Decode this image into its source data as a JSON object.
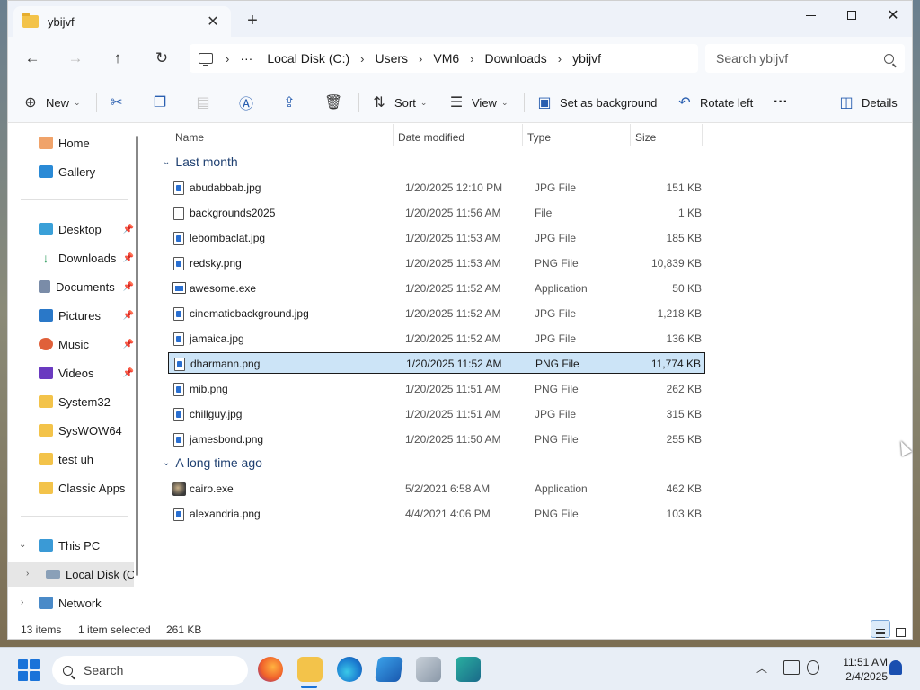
{
  "window": {
    "tab_title": "ybijvf",
    "tab_close": "✕",
    "new_tab": "+"
  },
  "address": {
    "ellipsis": "···",
    "crumbs": [
      "Local Disk (C:)",
      "Users",
      "VM6",
      "Downloads",
      "ybijvf"
    ],
    "separator": "›",
    "search_placeholder": "Search ybijvf"
  },
  "commands": {
    "new_label": "New",
    "sort_label": "Sort",
    "view_label": "View",
    "set_bg_label": "Set as background",
    "rotate_label": "Rotate left",
    "more_label": "···",
    "details_label": "Details"
  },
  "sidebar": {
    "home": "Home",
    "gallery": "Gallery",
    "desktop": "Desktop",
    "downloads": "Downloads",
    "documents": "Documents",
    "pictures": "Pictures",
    "music": "Music",
    "videos": "Videos",
    "system32": "System32",
    "syswow64": "SysWOW64",
    "test_uh": "test uh",
    "classic_apps": "Classic Apps",
    "this_pc": "This PC",
    "local_disk": "Local Disk (C:",
    "network": "Network"
  },
  "columns": {
    "name": "Name",
    "date": "Date modified",
    "type": "Type",
    "size": "Size"
  },
  "groups": {
    "last_month": "Last month",
    "long_ago": "A long time ago"
  },
  "files_last_month": [
    {
      "name": "abudabbab.jpg",
      "date": "1/20/2025 12:10 PM",
      "type": "JPG File",
      "size": "151 KB"
    },
    {
      "name": "backgrounds2025",
      "date": "1/20/2025 11:56 AM",
      "type": "File",
      "size": "1 KB"
    },
    {
      "name": "lebombaclat.jpg",
      "date": "1/20/2025 11:53 AM",
      "type": "JPG File",
      "size": "185 KB"
    },
    {
      "name": "redsky.png",
      "date": "1/20/2025 11:53 AM",
      "type": "PNG File",
      "size": "10,839 KB"
    },
    {
      "name": "awesome.exe",
      "date": "1/20/2025 11:52 AM",
      "type": "Application",
      "size": "50 KB"
    },
    {
      "name": "cinematicbackground.jpg",
      "date": "1/20/2025 11:52 AM",
      "type": "JPG File",
      "size": "1,218 KB"
    },
    {
      "name": "jamaica.jpg",
      "date": "1/20/2025 11:52 AM",
      "type": "JPG File",
      "size": "136 KB"
    },
    {
      "name": "dharmann.png",
      "date": "1/20/2025 11:52 AM",
      "type": "PNG File",
      "size": "11,774 KB"
    },
    {
      "name": "mib.png",
      "date": "1/20/2025 11:51 AM",
      "type": "PNG File",
      "size": "262 KB"
    },
    {
      "name": "chillguy.jpg",
      "date": "1/20/2025 11:51 AM",
      "type": "JPG File",
      "size": "315 KB"
    },
    {
      "name": "jamesbond.png",
      "date": "1/20/2025 11:50 AM",
      "type": "PNG File",
      "size": "255 KB"
    }
  ],
  "files_long_ago": [
    {
      "name": "cairo.exe",
      "date": "5/2/2021 6:58 AM",
      "type": "Application",
      "size": "462 KB"
    },
    {
      "name": "alexandria.png",
      "date": "4/4/2021 4:06 PM",
      "type": "PNG File",
      "size": "103 KB"
    }
  ],
  "status": {
    "item_count": "13 items",
    "selected": "1 item selected",
    "selected_size": "261 KB"
  },
  "taskbar": {
    "search_label": "Search",
    "time": "11:51 AM",
    "date": "2/4/2025"
  },
  "colors": {
    "accent": "#1a73d9",
    "selection": "#cce4f7",
    "group_header": "#1e3f70"
  }
}
